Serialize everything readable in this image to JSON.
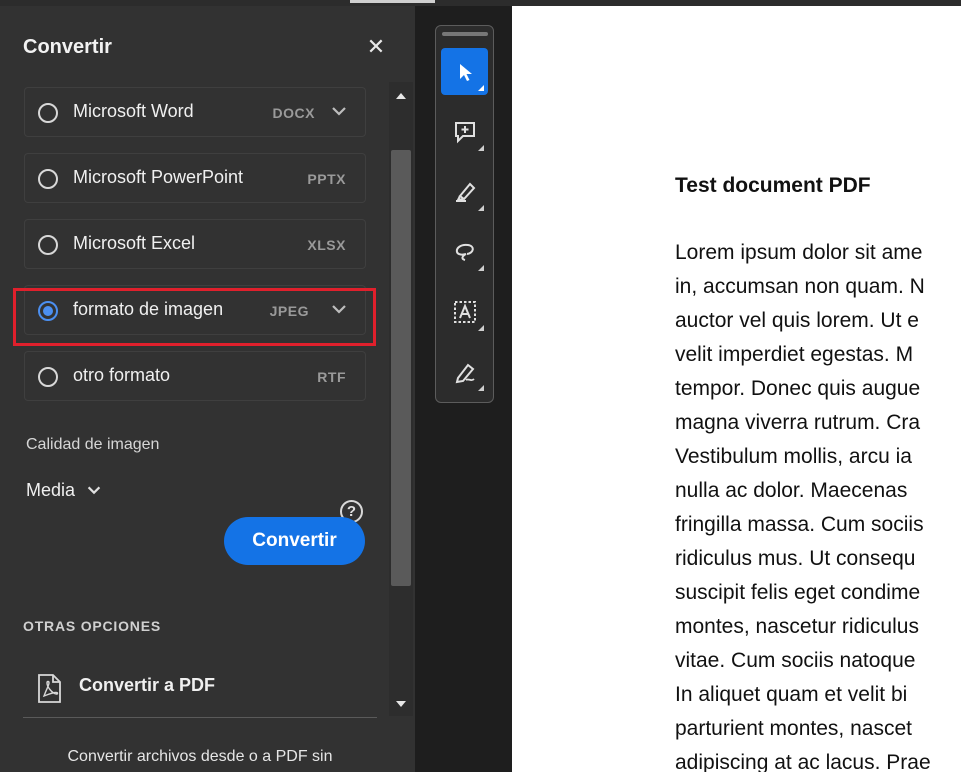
{
  "panel": {
    "title": "Convertir",
    "close_icon": "close-icon",
    "options": [
      {
        "label": "Microsoft Word",
        "ext": "DOCX",
        "selected": false,
        "has_dropdown": true
      },
      {
        "label": "Microsoft PowerPoint",
        "ext": "PPTX",
        "selected": false,
        "has_dropdown": false
      },
      {
        "label": "Microsoft Excel",
        "ext": "XLSX",
        "selected": false,
        "has_dropdown": false
      },
      {
        "label": "formato de imagen",
        "ext": "JPEG",
        "selected": true,
        "has_dropdown": true
      },
      {
        "label": "otro formato",
        "ext": "RTF",
        "selected": false,
        "has_dropdown": false
      }
    ],
    "quality_label": "Calidad de imagen",
    "quality_value": "Media",
    "help_icon_text": "?",
    "convert_button": "Convertir",
    "other_options_title": "OTRAS OPCIONES",
    "convert_to_pdf": "Convertir a PDF",
    "footer_text": "Convertir archivos desde o a PDF sin",
    "accent_color": "#1473e6",
    "highlight_color": "#e0202c"
  },
  "toolbar": {
    "tools": [
      "select-pointer-icon",
      "add-comment-icon",
      "highlight-pen-icon",
      "draw-freeform-icon",
      "text-box-icon",
      "sign-pen-icon"
    ],
    "active_tool": "select-pointer-icon"
  },
  "document": {
    "title": "Test document PDF",
    "lines": [
      "Lorem ipsum dolor sit ame",
      "in, accumsan non quam. N",
      "auctor vel quis lorem. Ut e",
      "velit imperdiet egestas. M",
      "tempor. Donec quis augue",
      "magna viverra rutrum. Cra",
      "Vestibulum mollis, arcu ia",
      "nulla ac dolor. Maecenas",
      "fringilla massa. Cum sociis",
      "ridiculus mus. Ut consequ",
      "suscipit felis eget condime",
      "montes, nascetur ridiculus",
      "vitae. Cum sociis natoque",
      "In aliquet quam et velit bi",
      "parturient montes, nascet",
      "adipiscing at ac lacus. Prae"
    ]
  }
}
